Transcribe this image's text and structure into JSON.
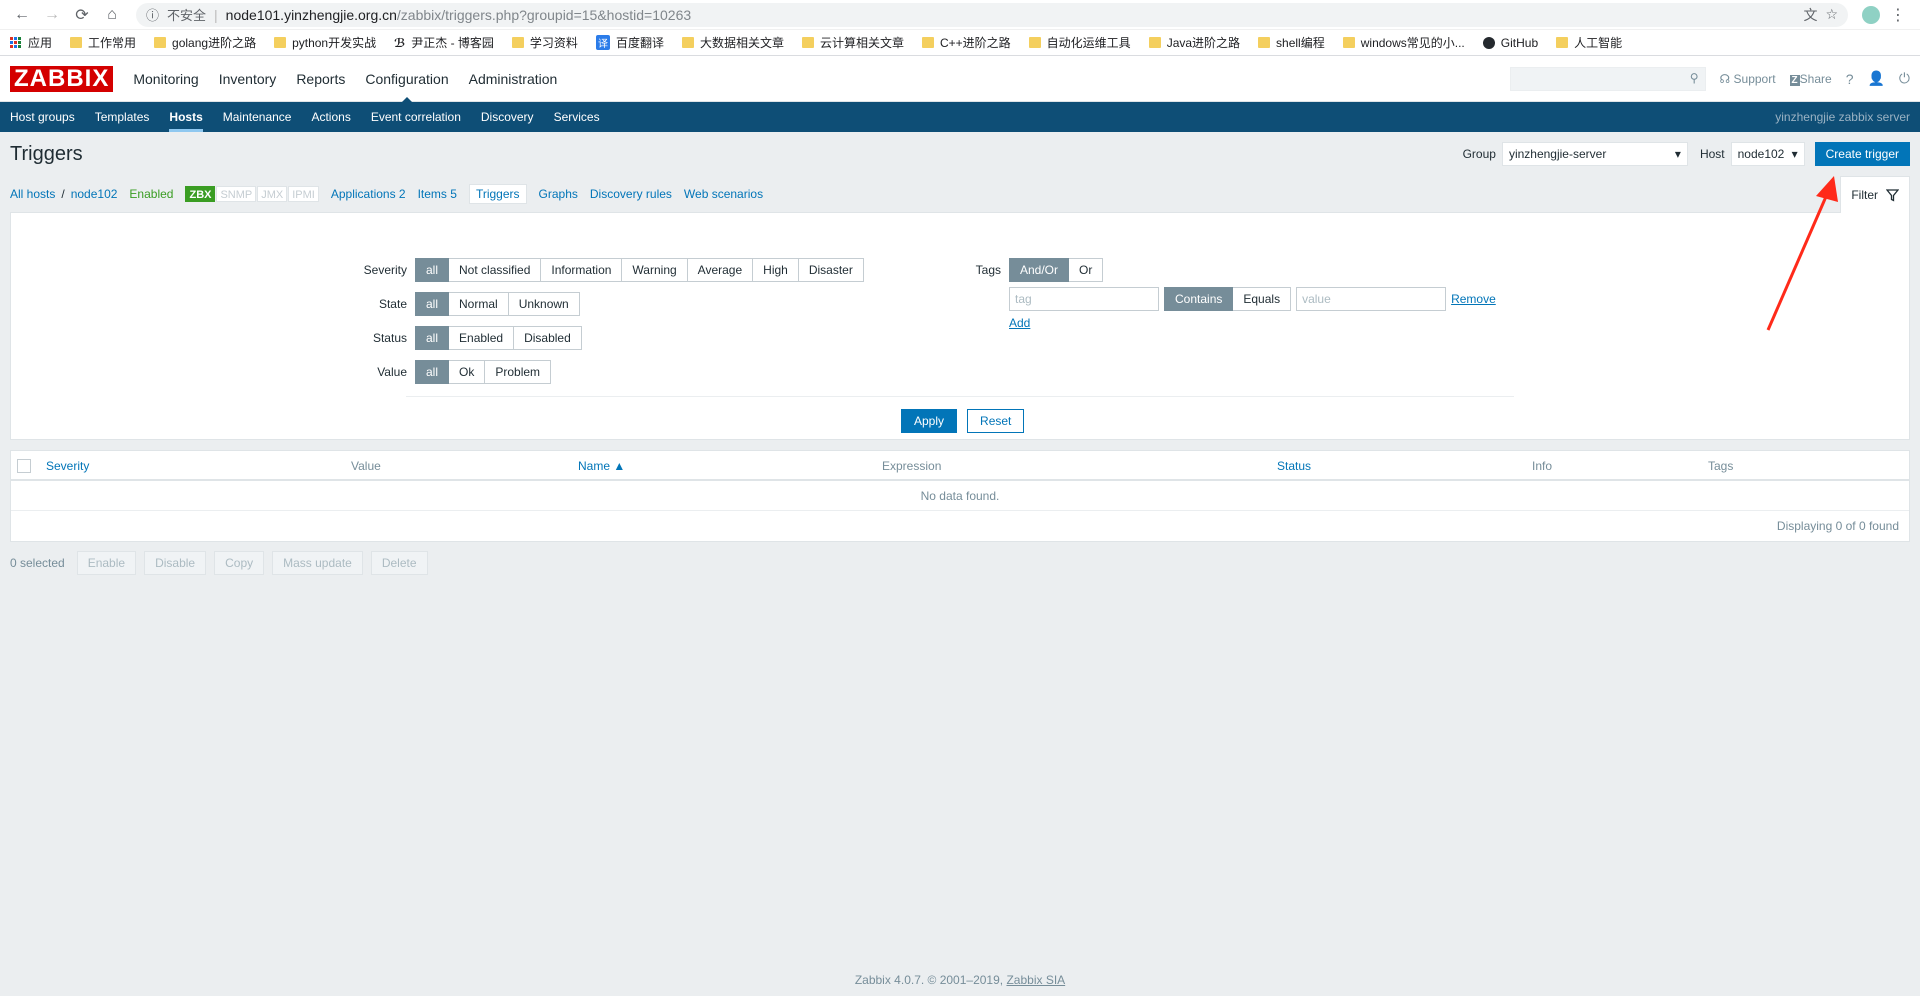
{
  "browser": {
    "security": "不安全",
    "url_host": "node101.yinzhengjie.org.cn",
    "url_path": "/zabbix/triggers.php?groupid=15&hostid=10263"
  },
  "bookmarks": [
    "应用",
    "工作常用",
    "golang进阶之路",
    "python开发实战",
    "尹正杰 - 博客园",
    "学习资料",
    "百度翻译",
    "大数据相关文章",
    "云计算相关文章",
    "C++进阶之路",
    "自动化运维工具",
    "Java进阶之路",
    "shell编程",
    "windows常见的小...",
    "GitHub",
    "人工智能"
  ],
  "topnav": {
    "logo": "ZABBIX",
    "menu": [
      "Monitoring",
      "Inventory",
      "Reports",
      "Configuration",
      "Administration"
    ],
    "support": "Support",
    "share": "Share",
    "help": "?"
  },
  "subnav": {
    "items": [
      "Host groups",
      "Templates",
      "Hosts",
      "Maintenance",
      "Actions",
      "Event correlation",
      "Discovery",
      "Services"
    ],
    "server_name": "yinzhengjie zabbix server"
  },
  "header": {
    "title": "Triggers",
    "group_label": "Group",
    "group_value": "yinzhengjie-server",
    "host_label": "Host",
    "host_value": "node102",
    "create_button": "Create trigger"
  },
  "host_tabs": {
    "all_hosts": "All hosts",
    "slash": "/",
    "host": "node102",
    "status": "Enabled",
    "badges": [
      "ZBX",
      "SNMP",
      "JMX",
      "IPMI"
    ],
    "applications": "Applications 2",
    "items": "Items 5",
    "triggers": "Triggers",
    "graphs": "Graphs",
    "discovery": "Discovery rules",
    "web": "Web scenarios",
    "filter": "Filter"
  },
  "filter": {
    "severity_label": "Severity",
    "severity": [
      "all",
      "Not classified",
      "Information",
      "Warning",
      "Average",
      "High",
      "Disaster"
    ],
    "state_label": "State",
    "state": [
      "all",
      "Normal",
      "Unknown"
    ],
    "status_label": "Status",
    "status": [
      "all",
      "Enabled",
      "Disabled"
    ],
    "value_label": "Value",
    "value": [
      "all",
      "Ok",
      "Problem"
    ],
    "tags_label": "Tags",
    "tags_mode": [
      "And/Or",
      "Or"
    ],
    "tag_placeholder": "tag",
    "op": [
      "Contains",
      "Equals"
    ],
    "value_placeholder": "value",
    "remove": "Remove",
    "add": "Add",
    "apply": "Apply",
    "reset": "Reset"
  },
  "table": {
    "columns": [
      "Severity",
      "Value",
      "Name ▲",
      "Expression",
      "Status",
      "Info",
      "Tags"
    ],
    "no_data": "No data found.",
    "paging": "Displaying 0 of 0 found"
  },
  "actions": {
    "selected": "0 selected",
    "buttons": [
      "Enable",
      "Disable",
      "Copy",
      "Mass update",
      "Delete"
    ]
  },
  "footer": {
    "text": "Zabbix 4.0.7. © 2001–2019,",
    "link": "Zabbix SIA"
  },
  "colors": {
    "accent": "#0275b8",
    "nav": "#0e4e76",
    "logo": "#d40000",
    "annotation_arrow": "#ff2a1a"
  }
}
